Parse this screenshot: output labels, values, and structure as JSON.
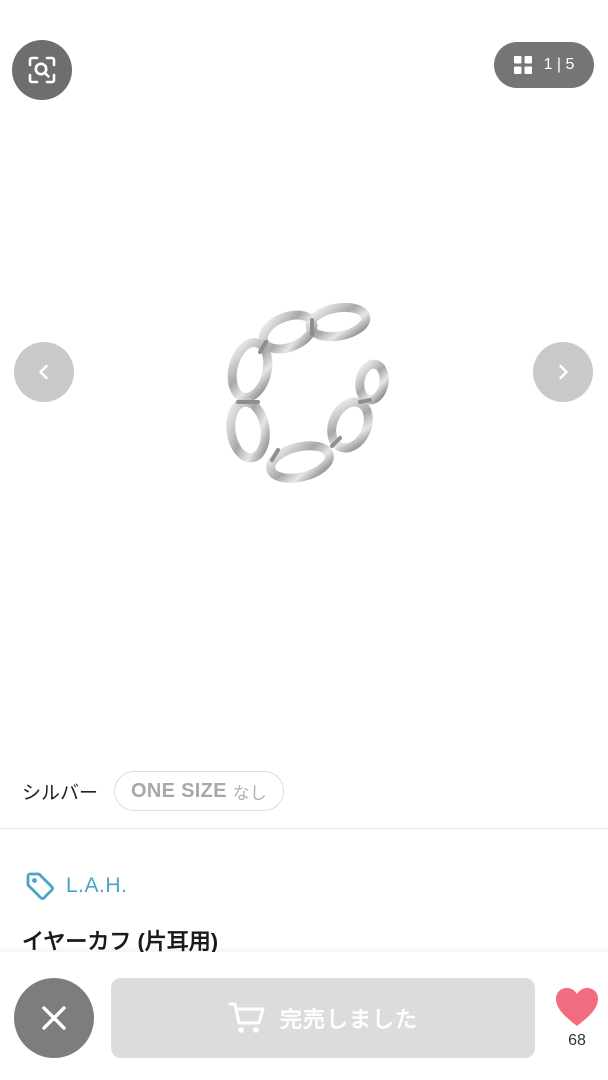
{
  "gallery": {
    "current_index": "1",
    "separator": "|",
    "total": "5",
    "lens_icon": "visual-search-icon",
    "grid_icon": "grid-icon",
    "prev_icon": "chevron-left-icon",
    "next_icon": "chevron-right-icon"
  },
  "variant": {
    "color": "シルバー",
    "size": "ONE SIZE",
    "stock": "なし"
  },
  "product": {
    "brand": "L.A.H.",
    "title": "イヤーカフ (片耳用)"
  },
  "bottom_bar": {
    "close_icon": "close-icon",
    "cart_icon": "cart-icon",
    "soldout_label": "完売しました",
    "favorite_icon": "heart-icon",
    "favorite_count": "68"
  },
  "colors": {
    "brand_accent": "#4aa3c8",
    "heart": "#f06c7e",
    "soldout_bg": "#dcdcdc"
  }
}
